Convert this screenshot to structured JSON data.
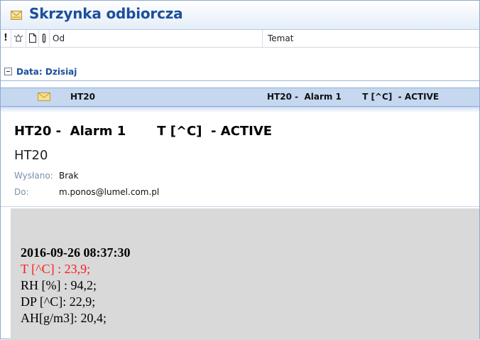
{
  "window": {
    "title": "Skrzynka odbiorcza"
  },
  "columns": {
    "importance_glyph": "!",
    "from": "Od",
    "subject": "Temat"
  },
  "group": {
    "label": "Data: Dzisiaj"
  },
  "message_row": {
    "from": "HT20",
    "subject": "HT20 -  Alarm 1       T [^C]  - ACTIVE"
  },
  "preview": {
    "subject": "HT20 -  Alarm 1       T [^C]  - ACTIVE",
    "sender": "HT20",
    "sent_label": "Wysłano:",
    "sent_value": "Brak",
    "to_label": "Do:",
    "to_value": "m.ponos@lumel.com.pl"
  },
  "body": {
    "timestamp": "2016-09-26 08:37:30",
    "lines": [
      "T [^C] : 23,9;",
      "RH [%] : 94,2;",
      "DP [^C]: 22,9;",
      "AH[g/m3]: 20,4;"
    ],
    "highlight_color": "#ff1a1a"
  },
  "icons": {
    "title": "inbox-envelope-icon",
    "importance": "exclamation-icon",
    "reminder": "alarm-bell-icon",
    "document": "document-icon",
    "attachment": "paperclip-icon",
    "collapse": "minus-box-icon",
    "unread": "envelope-icon"
  }
}
